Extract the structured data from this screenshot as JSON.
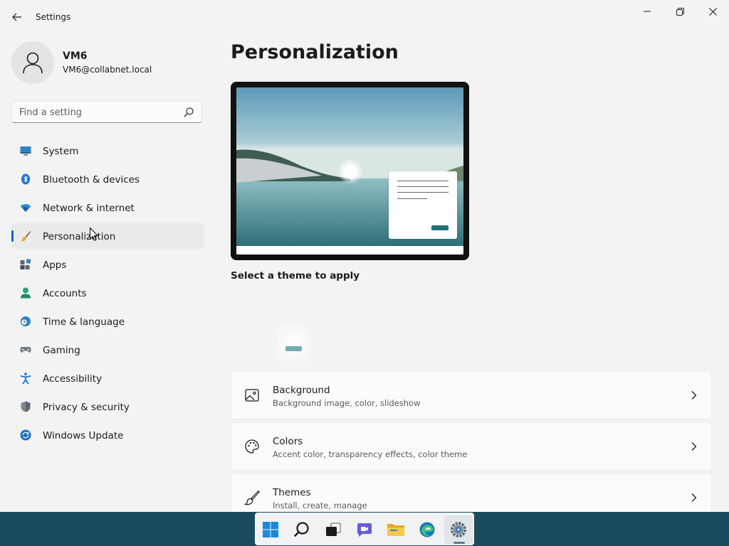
{
  "window": {
    "title": "Settings"
  },
  "profile": {
    "name": "VM6",
    "email": "VM6@collabnet.local"
  },
  "search": {
    "placeholder": "Find a setting"
  },
  "sidebar": {
    "items": [
      {
        "label": "System",
        "icon": "system-icon"
      },
      {
        "label": "Bluetooth & devices",
        "icon": "bluetooth-icon"
      },
      {
        "label": "Network & internet",
        "icon": "wifi-icon"
      },
      {
        "label": "Personalization",
        "icon": "brush-icon",
        "selected": true
      },
      {
        "label": "Apps",
        "icon": "apps-icon"
      },
      {
        "label": "Accounts",
        "icon": "accounts-icon"
      },
      {
        "label": "Time & language",
        "icon": "globe-clock-icon"
      },
      {
        "label": "Gaming",
        "icon": "gamepad-icon"
      },
      {
        "label": "Accessibility",
        "icon": "accessibility-icon"
      },
      {
        "label": "Privacy & security",
        "icon": "shield-icon"
      },
      {
        "label": "Windows Update",
        "icon": "update-icon"
      }
    ]
  },
  "main": {
    "title": "Personalization",
    "theme_caption": "Select a theme to apply",
    "cards": [
      {
        "title": "Background",
        "subtitle": "Background image, color, slideshow",
        "icon": "picture-icon"
      },
      {
        "title": "Colors",
        "subtitle": "Accent color, transparency effects, color theme",
        "icon": "palette-icon"
      },
      {
        "title": "Themes",
        "subtitle": "Install, create, manage",
        "icon": "brush-icon"
      }
    ]
  },
  "taskbar": {
    "apps": [
      "start-icon",
      "search-icon",
      "task-view-icon",
      "chat-icon",
      "file-explorer-icon",
      "edge-icon",
      "settings-icon"
    ],
    "active": "settings-icon"
  },
  "colors": {
    "accent": "#0067c0",
    "taskbar": "#1b4c5e",
    "theme_accent": "#1e6f7a"
  }
}
